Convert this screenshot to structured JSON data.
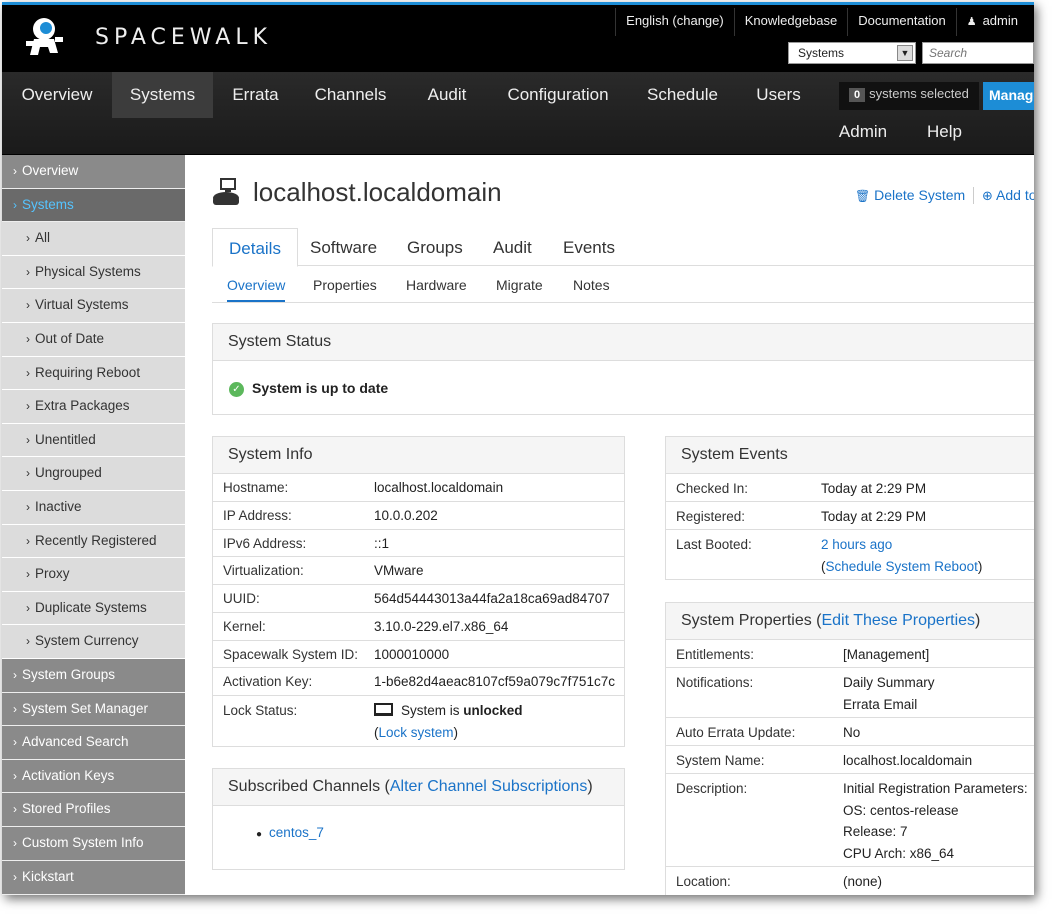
{
  "brand": "SPACEWALK",
  "toplinks": {
    "language": "English (change)",
    "knowledgebase": "Knowledgebase",
    "documentation": "Documentation",
    "user": "admin"
  },
  "search": {
    "scope": "Systems",
    "placeholder": "Search"
  },
  "nav": [
    "Overview",
    "Systems",
    "Errata",
    "Channels",
    "Audit",
    "Configuration",
    "Schedule",
    "Users",
    "Admin",
    "Help"
  ],
  "ssm": {
    "count": "0",
    "label": "systems selected",
    "manage": "Manage"
  },
  "sidebar": {
    "items": [
      {
        "label": "Overview",
        "type": "top"
      },
      {
        "label": "Systems",
        "type": "active"
      },
      {
        "label": "All",
        "type": "sub"
      },
      {
        "label": "Physical Systems",
        "type": "sub"
      },
      {
        "label": "Virtual Systems",
        "type": "sub"
      },
      {
        "label": "Out of Date",
        "type": "sub"
      },
      {
        "label": "Requiring Reboot",
        "type": "sub"
      },
      {
        "label": "Extra Packages",
        "type": "sub"
      },
      {
        "label": "Unentitled",
        "type": "sub"
      },
      {
        "label": "Ungrouped",
        "type": "sub"
      },
      {
        "label": "Inactive",
        "type": "sub"
      },
      {
        "label": "Recently Registered",
        "type": "sub"
      },
      {
        "label": "Proxy",
        "type": "sub"
      },
      {
        "label": "Duplicate Systems",
        "type": "sub"
      },
      {
        "label": "System Currency",
        "type": "sub"
      },
      {
        "label": "System Groups",
        "type": "top"
      },
      {
        "label": "System Set Manager",
        "type": "top"
      },
      {
        "label": "Advanced Search",
        "type": "top"
      },
      {
        "label": "Activation Keys",
        "type": "top"
      },
      {
        "label": "Stored Profiles",
        "type": "top"
      },
      {
        "label": "Custom System Info",
        "type": "top"
      },
      {
        "label": "Kickstart",
        "type": "top"
      }
    ]
  },
  "page": {
    "title": "localhost.localdomain",
    "delete_system": "Delete System",
    "add_to": "Add to"
  },
  "tabs": [
    "Details",
    "Software",
    "Groups",
    "Audit",
    "Events"
  ],
  "subtabs": [
    "Overview",
    "Properties",
    "Hardware",
    "Migrate",
    "Notes"
  ],
  "status": {
    "heading": "System Status",
    "message": "System is up to date"
  },
  "system_info": {
    "heading": "System Info",
    "rows": [
      {
        "label": "Hostname:",
        "value": "localhost.localdomain"
      },
      {
        "label": "IP Address:",
        "value": "10.0.0.202"
      },
      {
        "label": "IPv6 Address:",
        "value": "::1"
      },
      {
        "label": "Virtualization:",
        "value": "VMware"
      },
      {
        "label": "UUID:",
        "value": "564d54443013a44fa2a18ca69ad84707"
      },
      {
        "label": "Kernel:",
        "value": "3.10.0-229.el7.x86_64"
      },
      {
        "label": "Spacewalk System ID:",
        "value": "1000010000"
      },
      {
        "label": "Activation Key:",
        "value": "1-b6e82d4aeac8107cf59a079c7f751c7c"
      }
    ],
    "lock_label": "Lock Status:",
    "lock_prefix": "System is",
    "lock_state": "unlocked",
    "lock_link": "Lock system"
  },
  "channels": {
    "heading_prefix": "Subscribed Channels (",
    "heading_link": "Alter Channel Subscriptions",
    "heading_suffix": ")",
    "items": [
      "centos_7"
    ]
  },
  "events": {
    "heading": "System Events",
    "checked_in_label": "Checked In:",
    "checked_in": "Today at 2:29 PM",
    "registered_label": "Registered:",
    "registered": "Today at 2:29 PM",
    "booted_label": "Last Booted:",
    "booted": "2 hours ago",
    "reboot_link": "Schedule System Reboot"
  },
  "properties": {
    "heading_prefix": "System Properties (",
    "heading_link": "Edit These Properties",
    "heading_suffix": ")",
    "entitlements_label": "Entitlements:",
    "entitlements": "[Management]",
    "notifications_label": "Notifications:",
    "notifications": [
      "Daily Summary",
      "Errata Email"
    ],
    "auto_errata_label": "Auto Errata Update:",
    "auto_errata": "No",
    "system_name_label": "System Name:",
    "system_name": "localhost.localdomain",
    "description_label": "Description:",
    "description": [
      "Initial Registration Parameters:",
      "OS: centos-release",
      "Release: 7",
      "CPU Arch: x86_64"
    ],
    "location_label": "Location:",
    "location": "(none)"
  }
}
